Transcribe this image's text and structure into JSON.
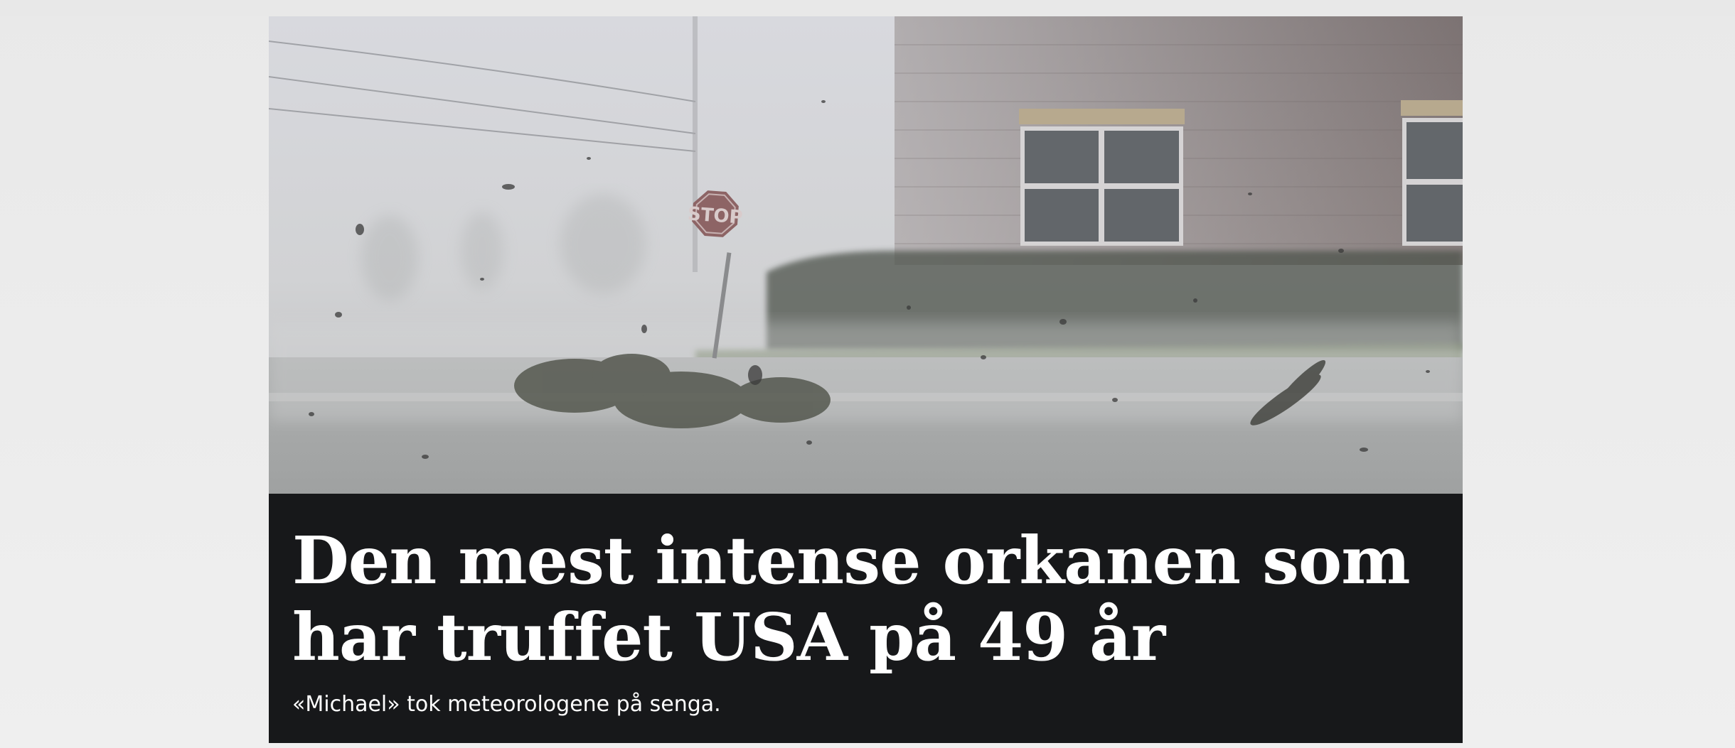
{
  "article": {
    "headline": "Den mest intense orkanen som har truffet USA på 49 år",
    "subtitle": "«Michael» tok meteorologene på senga.",
    "image": {
      "alt": "Orkan med stoppskilt, bygning og flygende rusk",
      "sign_text": "STOP"
    }
  },
  "colors": {
    "page_background": "#ececec",
    "headline_background": "#17181a",
    "headline_text": "#ffffff"
  }
}
